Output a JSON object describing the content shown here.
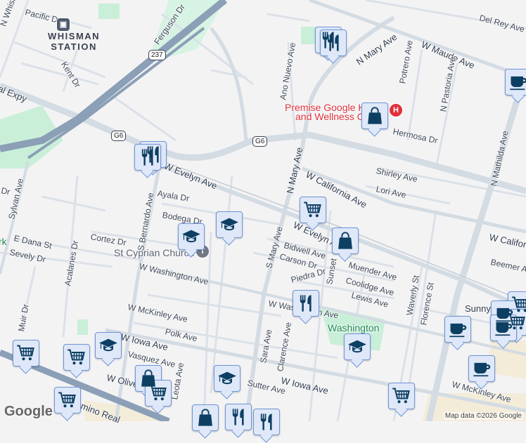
{
  "map": {
    "streets": {
      "n_whisman": "N Whisman",
      "pacific_dr": "Pacific Dr",
      "ferguson_dr": "Ferguson Dr",
      "kent_dr": "Kent Dr",
      "central_expy": "al Expy",
      "w_evelyn_ave": "W Evelyn Ave",
      "w_evelyn_ave_2": "W Evelyn Ave",
      "s_bernardo_ave": "S Bernardo Ave",
      "ayala_dr": "Ayala Dr",
      "sylvan_ave": "Sylvan Ave",
      "dr_partial": "n Dr",
      "bodega_dr": "Bodega Dr",
      "cortez_dr": "Cortez Dr",
      "e_dana_st": "E Dana St",
      "sevely_dr": "Sevely Dr",
      "acalanes_dr": "Acalanes Dr",
      "w_washington_ave": "W Washington Ave",
      "w_washington_ave_2": "W Washington Ave",
      "muir_dr": "Muir Dr",
      "w_mckinley_ave": "W McKinley Ave",
      "w_mckinley_ave_2": "W McKinley Ave",
      "polk_ave": "Polk Ave",
      "w_iowa_ave": "W Iowa Ave",
      "w_iowa_ave_2": "W Iowa Ave",
      "vasquez_ave": "Vasquez Ave",
      "leota_ave": "Leota Ave",
      "w_olive": "W Olive",
      "el_camino_real": "Camino Real",
      "sutter_ave": "Sutter Ave",
      "sara_ave": "Sara Ave",
      "clarence_ave": "Clarence Ave",
      "s_mary_ave": "S Mary Ave",
      "bidwell_ave": "Bidwell Ave",
      "carson_dr": "Carson Dr",
      "piedra_dr": "Piedra Dr",
      "sunset": "Sunset",
      "muender_ave": "Muender Ave",
      "coolidge_ave": "Coolidge Ave",
      "lewis_ave": "Lewis Ave",
      "waverly_st": "Waverly St",
      "florence_st": "Florence St",
      "w_california": "W California",
      "beemer_ave": "Beemer Ave",
      "hermosa_dr": "Hermosa Dr",
      "n_mary_ave": "N Mary Ave",
      "n_mary_ave_2": "N Mary Ave",
      "w_maude_ave": "W Maude Ave",
      "del_rey_ave": "Del Rey Ave",
      "ano_nuevo_ave": "Ano Nuevo Ave",
      "potrero_ave": "Potrero Ave",
      "n_pastoria_ave": "N Pastoria Ave",
      "n_mathilda_ave": "N Mathilda Ave",
      "w_california_ave": "W California Ave",
      "shirley_ave": "Shirley Ave",
      "lori_ave": "Lori Ave",
      "sunny": "Sunny"
    },
    "shields": {
      "ca_237": "237",
      "g6_a": "G6",
      "g6_b": "G6"
    },
    "places": {
      "whisman_station_1": "WHISMAN",
      "whisman_station_2": "STATION",
      "st_cyprian": "St Cyprian Church",
      "premise_1": "Premise Google H",
      "premise_2": "and Wellness C",
      "washington_park": "Washington",
      "park_partial": "rk"
    },
    "pin_labels": {
      "hospital": "H",
      "transit": "T"
    },
    "colors": {
      "highway": "#8b9fb7",
      "arterial": "#d3dbe3",
      "park": "#c9efd9",
      "marker_bg": "#dfe8f8",
      "icon": "#0d3f63"
    },
    "attribution": "Map data ©2026 Google",
    "logo": "Google"
  }
}
